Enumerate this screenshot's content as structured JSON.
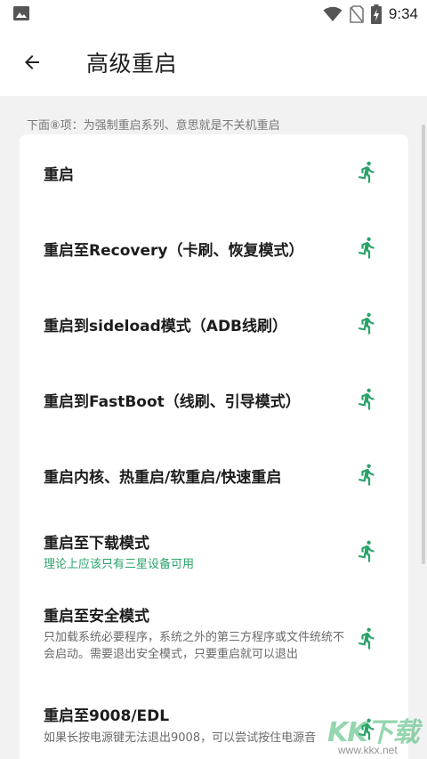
{
  "status_bar": {
    "time": "9:34",
    "icons": [
      "image-icon",
      "wifi-icon",
      "no-sim-icon",
      "battery-charging-icon"
    ]
  },
  "app_bar": {
    "title": "高级重启",
    "back_icon": "arrow-back-icon"
  },
  "section_note": "下面⑧项：为强制重启系列、意思就是不关机重启",
  "accent_color": "#2aa36a",
  "items": [
    {
      "title": "重启",
      "subtitle": ""
    },
    {
      "title": "重启至Recovery（卡刷、恢复模式）",
      "subtitle": ""
    },
    {
      "title": "重启到sideload模式（ADB线刷）",
      "subtitle": ""
    },
    {
      "title": "重启到FastBoot（线刷、引导模式）",
      "subtitle": ""
    },
    {
      "title": "重启内核、热重启/软重启/快速重启",
      "subtitle": ""
    },
    {
      "title": "重启至下载模式",
      "subtitle": "理论上应该只有三星设备可用"
    },
    {
      "title": "重启至安全模式",
      "subtitle": "只加载系统必要程序，系统之外的第三方程序或文件统统不会启动。需要退出安全模式，只要重启就可以退出"
    },
    {
      "title": "重启至9008/EDL",
      "subtitle": "如果长按电源键无法退出9008，可以尝试按住电源音"
    }
  ],
  "watermark": {
    "text": "KK下载",
    "url": "www.kkx.net"
  }
}
